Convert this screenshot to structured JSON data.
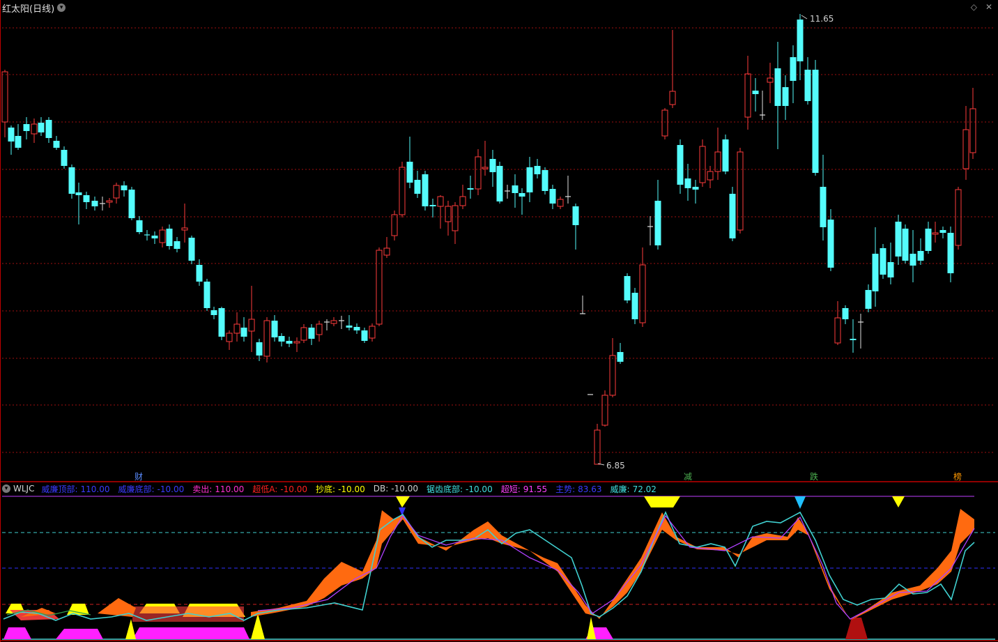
{
  "header": {
    "title": "红太阳(日线)",
    "collapse_icon": "chevron-down-icon"
  },
  "window_icons": [
    "diamond-icon",
    "close-icon"
  ],
  "price_labels": {
    "high": "11.65",
    "low": "6.85"
  },
  "event_markers": [
    {
      "label": "财",
      "color": "#5a8cff"
    },
    {
      "label": "减",
      "color": "#4caf50"
    },
    {
      "label": "跌",
      "color": "#4caf50"
    },
    {
      "label": "榜",
      "color": "#ff9800"
    }
  ],
  "indicator": {
    "name": "WLJC",
    "items": [
      {
        "label": "威廉顶部:",
        "value": "110.00",
        "color": "#3a3aff"
      },
      {
        "label": "威廉底部:",
        "value": "-10.00",
        "color": "#3a3aff"
      },
      {
        "label": "卖出:",
        "value": "110.00",
        "color": "#ff2fd0"
      },
      {
        "label": "超低A:",
        "value": "-10.00",
        "color": "#ff2020"
      },
      {
        "label": "抄底:",
        "value": "-10.00",
        "color": "#ffff00"
      },
      {
        "label": "DB:",
        "value": "-10.00",
        "color": "#d0d0d0"
      },
      {
        "label": "锯齿底部:",
        "value": "-10.00",
        "color": "#40e0e0"
      },
      {
        "label": "超短:",
        "value": "91.55",
        "color": "#ff40ff"
      },
      {
        "label": "主势:",
        "value": "83.63",
        "color": "#3a3aff"
      },
      {
        "label": "威廉:",
        "value": "72.02",
        "color": "#40e0e0"
      }
    ]
  },
  "colors": {
    "up": "#ff3c3c",
    "down": "#54fcfc",
    "grid": "#8b0000",
    "orange": "#ff6a10",
    "yellow": "#ffff00",
    "magenta": "#ff20ff",
    "cyan": "#40d0d0",
    "purple": "#b040ff"
  }
}
